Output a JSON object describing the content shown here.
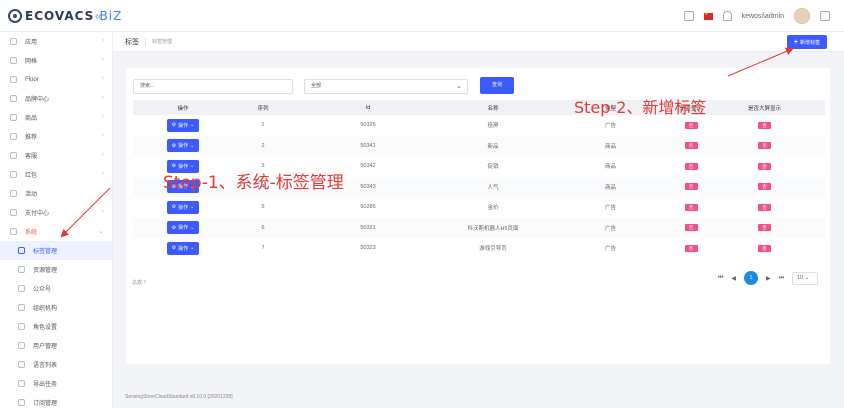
{
  "header": {
    "logo_main": "ECOVACS",
    "logo_suffix": "BiZ",
    "username": "kewosi\\admin"
  },
  "sidebar": {
    "items": [
      {
        "label": "应用",
        "arrow": true
      },
      {
        "label": "网格",
        "arrow": true
      },
      {
        "label": "Floor",
        "arrow": true
      },
      {
        "label": "品牌中心",
        "arrow": true
      },
      {
        "label": "商品",
        "arrow": true
      },
      {
        "label": "推荐",
        "arrow": true
      },
      {
        "label": "客服",
        "arrow": true
      },
      {
        "label": "红包",
        "arrow": true
      },
      {
        "label": "活动",
        "arrow": false
      },
      {
        "label": "支付中心",
        "arrow": true
      },
      {
        "label": "系统",
        "arrow": true,
        "expanded": true
      }
    ],
    "subitems": [
      {
        "label": "标签管理",
        "active": true
      },
      {
        "label": "资源管理"
      },
      {
        "label": "公众号"
      },
      {
        "label": "组织机构"
      },
      {
        "label": "角色设置"
      },
      {
        "label": "用户管理"
      },
      {
        "label": "语言列表"
      },
      {
        "label": "导出任务"
      },
      {
        "label": "订阅管理"
      }
    ]
  },
  "breadcrumb": {
    "title": "标签",
    "sub": "标签管理"
  },
  "toolbar": {
    "add_label": "新增标签",
    "search_placeholder": "搜索...",
    "select_value": "全部",
    "query_label": "查询"
  },
  "table": {
    "headers": [
      "操作",
      "序列",
      "Id",
      "名称",
      "类型",
      "是否显示",
      "是否大屏显示"
    ],
    "op_label": "操作",
    "rows": [
      {
        "seq": "1",
        "id": "50326",
        "name": "投屏",
        "type": "广告",
        "show": "否",
        "big": "否"
      },
      {
        "seq": "2",
        "id": "50341",
        "name": "新品",
        "type": "商品",
        "show": "否",
        "big": "否"
      },
      {
        "seq": "3",
        "id": "50342",
        "name": "促销",
        "type": "商品",
        "show": "否",
        "big": "否"
      },
      {
        "seq": "4",
        "id": "50343",
        "name": "人气",
        "type": "商品",
        "show": "否",
        "big": "否"
      },
      {
        "seq": "5",
        "id": "50285",
        "name": "金价",
        "type": "广告",
        "show": "否",
        "big": "否"
      },
      {
        "seq": "6",
        "id": "50321",
        "name": "科沃斯机器人H5页面",
        "type": "广告",
        "show": "否",
        "big": "否"
      },
      {
        "seq": "7",
        "id": "50323",
        "name": "游戏引导页",
        "type": "广告",
        "show": "否",
        "big": "否"
      }
    ]
  },
  "pagination": {
    "total": "总数:7",
    "current": "1",
    "page_size": "10"
  },
  "footer": {
    "version": "SensingStoreCloudStandard v8.10.0 [20201228]"
  },
  "annotations": {
    "step1": "Step-1、系统-标签管理",
    "step2": "Step-2、新增标签",
    "color": "#e53935"
  },
  "colors": {
    "primary": "#3d5afe",
    "badge": "#f25287",
    "pager_active": "#1e88e5"
  }
}
